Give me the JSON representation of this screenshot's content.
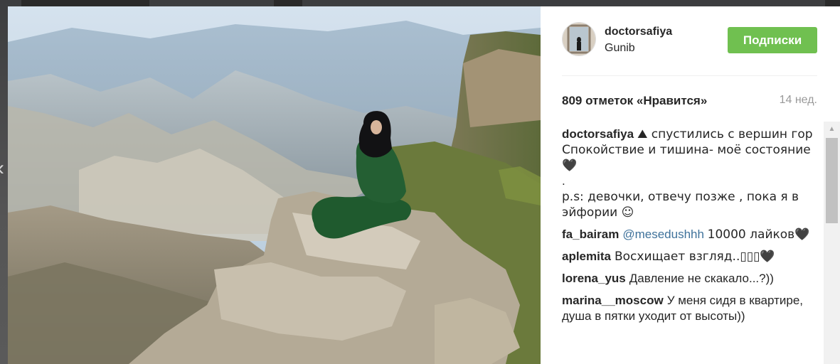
{
  "post": {
    "username": "doctorsafiya",
    "location": "Gunib",
    "follow_button": "Подписки",
    "likes": "809 отметок «Нравится»",
    "time_ago": "14 нед."
  },
  "caption": {
    "author": "doctorsafiya",
    "line1": "⛰ спустились с вершин гор",
    "line2": "Спокойствие и тишина- моё состояние 🖤",
    "line3": ".",
    "line4": "p.s: девочки, отвечу позже , пока я в эйфории ☺"
  },
  "comments": [
    {
      "author": "fa_bairam",
      "mention": "@mesedushhh",
      "text": "10000 лайков🖤"
    },
    {
      "author": "aplemita",
      "text": "Восхищает взгляд..▯▯▯🖤"
    },
    {
      "author": "lorena_yus",
      "text": "Давление не скакало...?))"
    },
    {
      "author": "marina__moscow",
      "text": "У меня сидя в квартире, душа в пятки уходит от высоты))"
    }
  ],
  "icons": {
    "prev_arrow": "‹",
    "scroll_up": "▲"
  },
  "colors": {
    "follow_button": "#70c050",
    "mention": "#3f729b",
    "muted": "#999999"
  }
}
